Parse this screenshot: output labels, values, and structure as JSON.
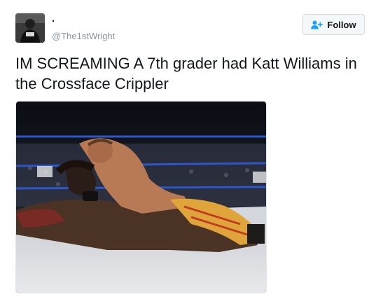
{
  "user": {
    "display_name": ".",
    "screen_name": "@The1stWright",
    "avatar_icon": "user-avatar"
  },
  "follow_button": {
    "label": "Follow",
    "icon": "add-user-icon",
    "accent": "#1da1f2"
  },
  "tweet": {
    "text": "IM SCREAMING A 7th grader had Katt Williams in the Crossface Crippler"
  },
  "media": {
    "type": "photo",
    "subject": "wrestling-photo"
  }
}
